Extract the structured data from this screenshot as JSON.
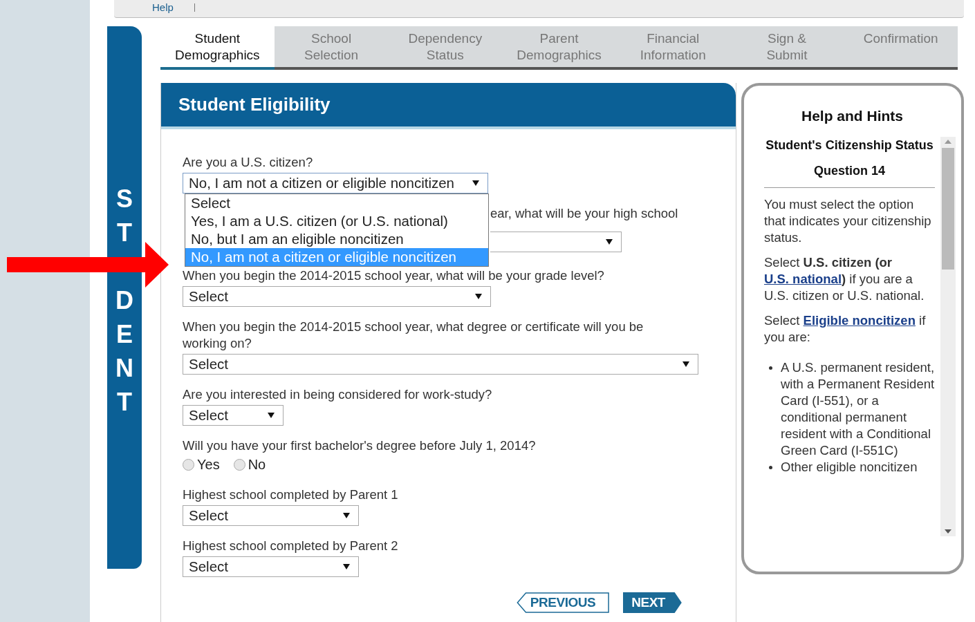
{
  "top_bar": {
    "link": "Help"
  },
  "side_band": {
    "letters_top": [
      "S",
      "T"
    ],
    "letters_bottom": [
      "D",
      "E",
      "N",
      "T"
    ]
  },
  "tabs": [
    {
      "lines": [
        "Student",
        "Demographics"
      ],
      "selected": true
    },
    {
      "lines": [
        "School",
        "Selection"
      ],
      "selected": false
    },
    {
      "lines": [
        "Dependency",
        "Status"
      ],
      "selected": false
    },
    {
      "lines": [
        "Parent",
        "Demographics"
      ],
      "selected": false
    },
    {
      "lines": [
        "Financial",
        "Information"
      ],
      "selected": false
    },
    {
      "lines": [
        "Sign &",
        "Submit"
      ],
      "selected": false
    },
    {
      "lines": [
        "Confirmation"
      ],
      "selected": false
    }
  ],
  "form": {
    "title": "Student Eligibility",
    "questions": [
      {
        "kind": "select",
        "label": "Are you a U.S. citizen?",
        "value": "No, I am not a citizen or eligible noncitizen",
        "open": true,
        "options": [
          {
            "label": "Select",
            "selected": false
          },
          {
            "label": "Yes, I am a U.S. citizen (or U.S. national)",
            "selected": false
          },
          {
            "label": "No, but I am an eligible noncitizen",
            "selected": false
          },
          {
            "label": "No, I am not a citizen or eligible noncitizen",
            "selected": true
          }
        ]
      },
      {
        "kind": "hidden-select",
        "label": "ear, what will be your high school"
      },
      {
        "kind": "select",
        "label": "When you begin the 2014-2015 school year, what will be your grade level?",
        "value": "Select",
        "open": false
      },
      {
        "kind": "select",
        "label": "When you begin the 2014-2015 school year, what degree or certificate will you be working on?",
        "value": "Select",
        "open": false
      },
      {
        "kind": "select",
        "label": "Are you interested in being considered for work-study?",
        "value": "Select",
        "open": false
      },
      {
        "kind": "radio",
        "label": "Will you have your first bachelor's degree before July 1, 2014?",
        "choices": [
          {
            "label": "Yes",
            "selected": false
          },
          {
            "label": "No",
            "selected": false
          }
        ]
      },
      {
        "kind": "select",
        "label": "Highest school completed by Parent 1",
        "value": "Select",
        "open": false
      },
      {
        "kind": "select",
        "label": "Highest school completed by Parent 2",
        "value": "Select",
        "open": false
      }
    ],
    "buttons": [
      {
        "kind": "previous",
        "label": "PREVIOUS"
      },
      {
        "kind": "next",
        "label": "NEXT"
      }
    ]
  },
  "help": {
    "title": "Help and Hints",
    "subtitle": "Student's Citizenship Status",
    "question": "Question 14",
    "paragraphs": [
      [
        {
          "text": "You must select the option that indicates your citizenship status."
        }
      ],
      [
        {
          "text": "Select "
        },
        {
          "text": "U.S. citizen (or ",
          "bold": true
        },
        {
          "text": "U.S. national",
          "link": true
        },
        {
          "text": ")",
          "bold": true
        },
        {
          "text": " if you are a U.S. citizen or U.S. national."
        }
      ],
      [
        {
          "text": "Select "
        },
        {
          "text": "Eligible noncitizen",
          "link": true
        },
        {
          "text": " if you are:"
        }
      ]
    ],
    "bullets": [
      "A U.S. permanent resident, with a Permanent Resident Card (I-551), or a conditional permanent resident with a Conditional Green Card (I-551C)",
      "Other eligible noncitizen"
    ]
  }
}
